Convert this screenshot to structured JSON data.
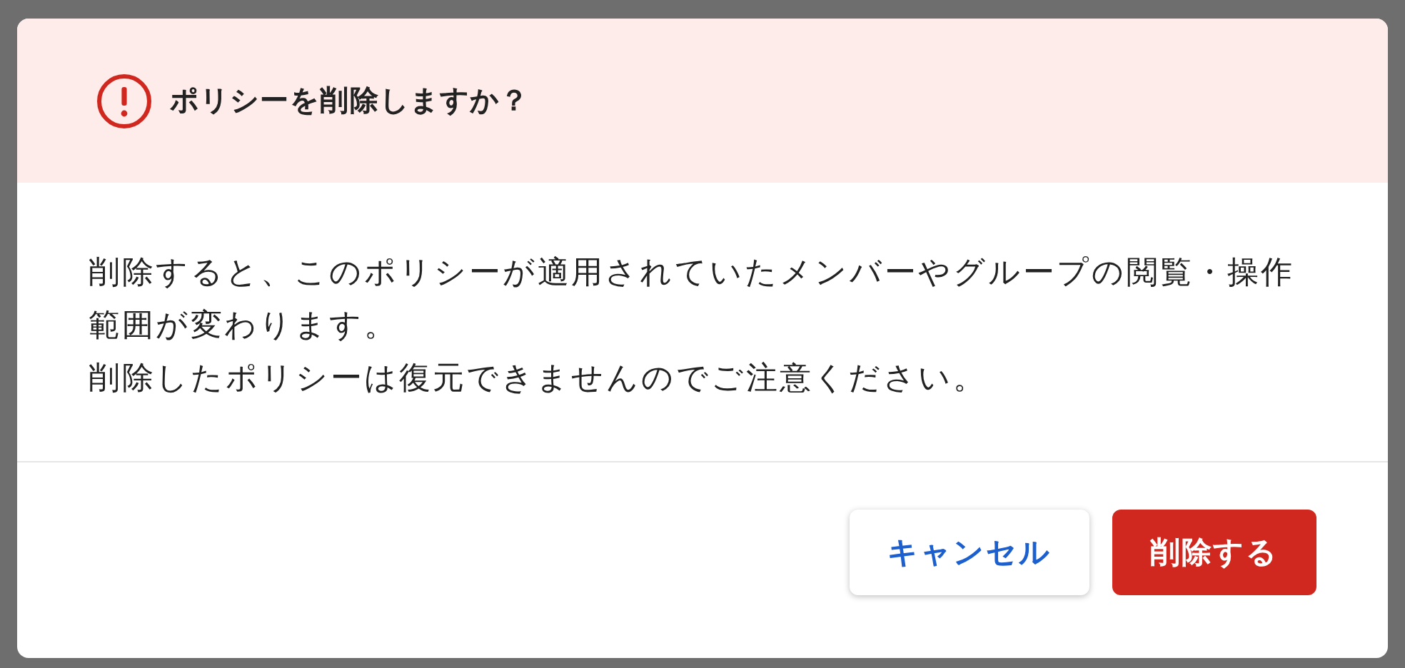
{
  "dialog": {
    "title": "ポリシーを削除しますか？",
    "paragraphs": [
      "削除すると、このポリシーが適用されていたメンバーやグループの閲覧・操作範囲が変わります。",
      "削除したポリシーは復元できませんのでご注意ください。"
    ],
    "buttons": [
      {
        "label": "キャンセル",
        "kind": "secondary"
      },
      {
        "label": "削除する",
        "kind": "danger"
      }
    ]
  }
}
